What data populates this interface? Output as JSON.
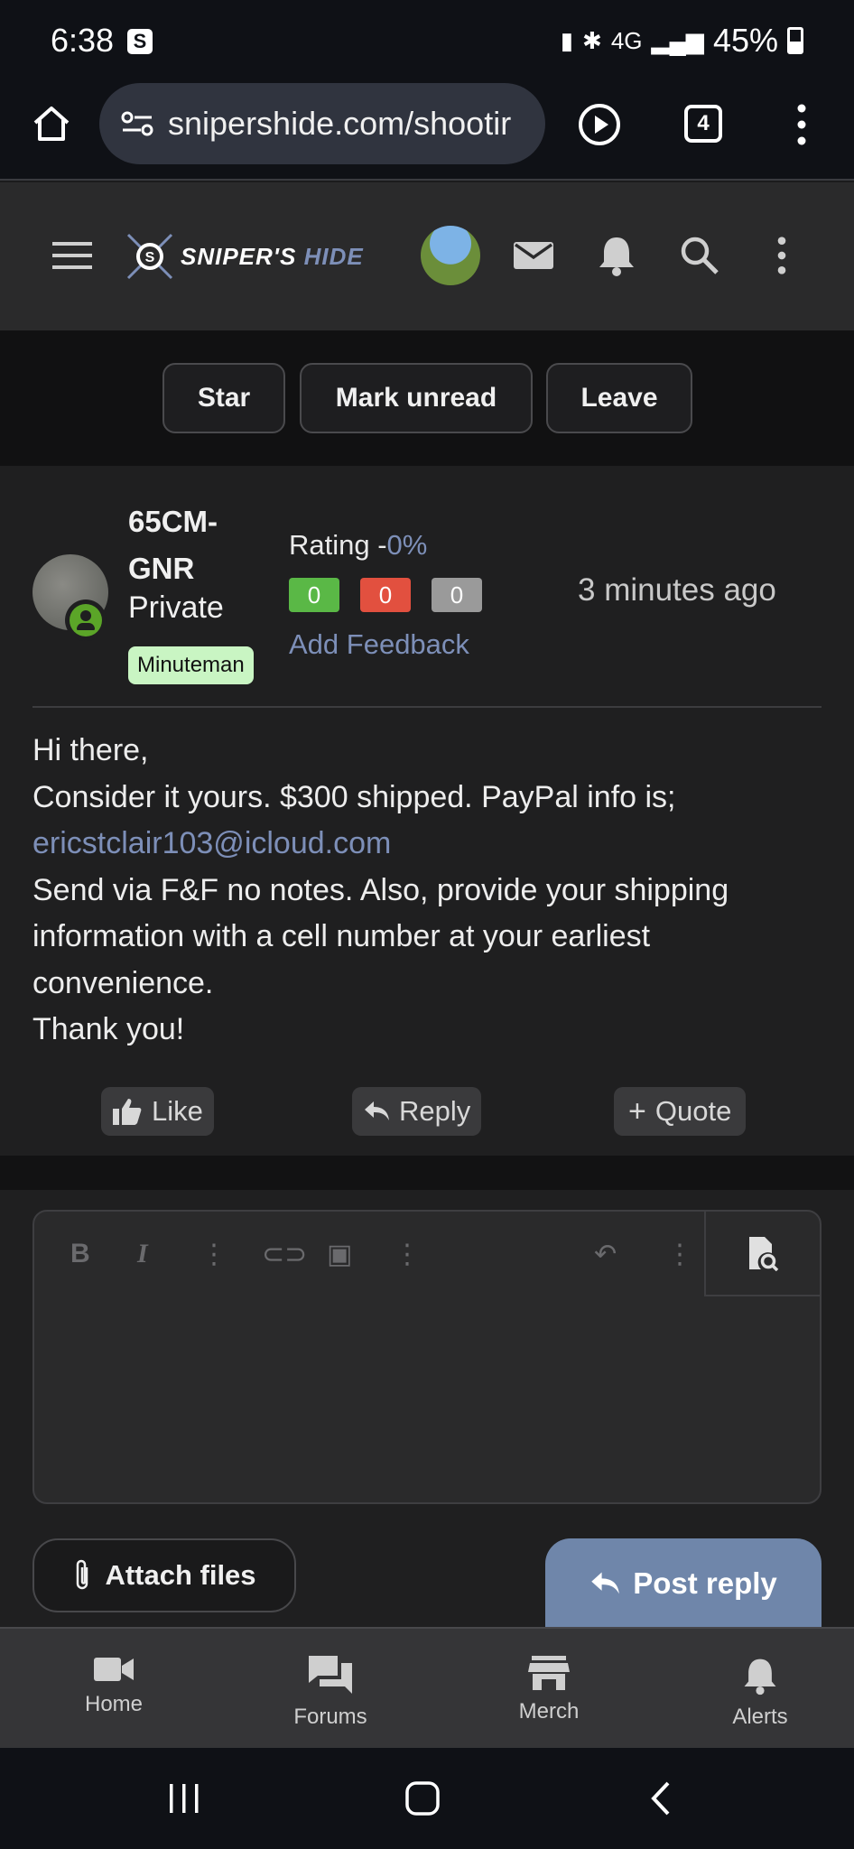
{
  "status_bar": {
    "time": "6:38",
    "battery": "45%",
    "network": "4G"
  },
  "browser": {
    "url": "snipershide.com/shootir",
    "tab_count": "4"
  },
  "site": {
    "logo_sniper": "SNIPER'S",
    "logo_hide": "HIDE"
  },
  "thread_actions": {
    "star": "Star",
    "mark_unread": "Mark unread",
    "leave": "Leave"
  },
  "post": {
    "username": "65CM-GNR",
    "user_title": "Private",
    "badge": "Minuteman",
    "rating_label": "Rating -",
    "rating_value": "0%",
    "feedback_positive": "0",
    "feedback_negative": "0",
    "feedback_neutral": "0",
    "add_feedback": "Add Feedback",
    "time": "3 minutes ago",
    "body_line1": "Hi there,",
    "body_line2": "Consider it yours. $300 shipped. PayPal info is;",
    "body_email": "ericstclair103@icloud.com",
    "body_line4": "Send via F&F no notes. Also, provide your shipping information with a cell number at your earliest convenience.",
    "body_line5": "Thank you!",
    "like": "Like",
    "reply": "Reply",
    "quote": "Quote"
  },
  "editor": {
    "attach_files": "Attach files",
    "post_reply": "Post reply"
  },
  "bottom_nav": {
    "home": "Home",
    "forums": "Forums",
    "merch": "Merch",
    "alerts": "Alerts"
  },
  "colors": {
    "accent": "#7d8fb8",
    "positive": "#5ab846",
    "negative": "#e2503f",
    "neutral": "#9a9a9a",
    "post_reply": "#6f86aa"
  }
}
